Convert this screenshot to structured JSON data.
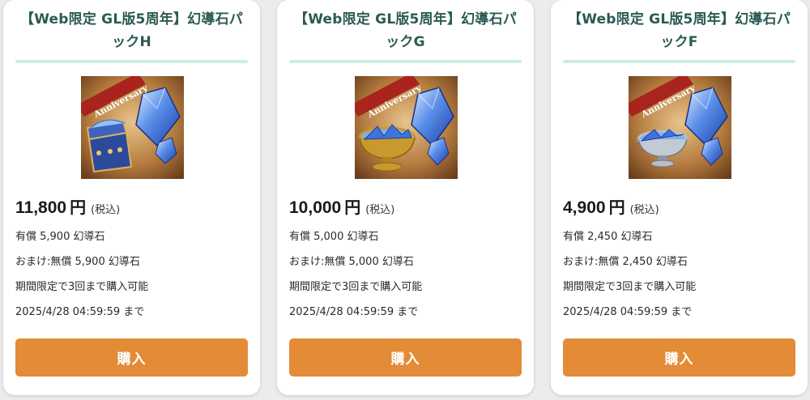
{
  "colors": {
    "title": "#2a5a52",
    "title_rule": "#cdece8",
    "buy_button": "#e48b37",
    "page_bg": "#ececec"
  },
  "products": [
    {
      "title": "【Web限定 GL版5周年】幻導石パックH",
      "banner_text": "Anniversary",
      "image_icon": "treasure-chest-crystals",
      "price": "11,800",
      "currency": "円",
      "tax_note": "(税込)",
      "paid": "有償 5,900 幻導石",
      "bonus": "おまけ:無償 5,900 幻導石",
      "limit": "期間限定で3回まで購入可能",
      "deadline": "2025/4/28 04:59:59 まで",
      "buy_label": "購入"
    },
    {
      "title": "【Web限定 GL版5周年】幻導石パックG",
      "banner_text": "Anniversary",
      "image_icon": "golden-bowl-crystals",
      "price": "10,000",
      "currency": "円",
      "tax_note": "(税込)",
      "paid": "有償 5,000 幻導石",
      "bonus": "おまけ:無償 5,000 幻導石",
      "limit": "期間限定で3回まで購入可能",
      "deadline": "2025/4/28 04:59:59 まで",
      "buy_label": "購入"
    },
    {
      "title": "【Web限定 GL版5周年】幻導石パックF",
      "banner_text": "Anniversary",
      "image_icon": "silver-bowl-crystals",
      "price": "4,900",
      "currency": "円",
      "tax_note": "(税込)",
      "paid": "有償 2,450 幻導石",
      "bonus": "おまけ:無償 2,450 幻導石",
      "limit": "期間限定で3回まで購入可能",
      "deadline": "2025/4/28 04:59:59 まで",
      "buy_label": "購入"
    }
  ]
}
